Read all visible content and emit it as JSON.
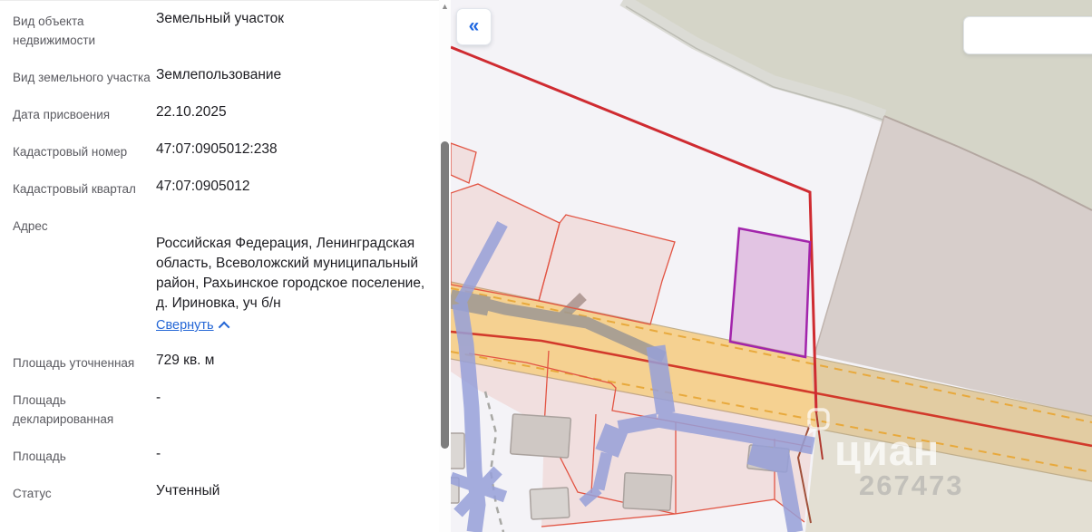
{
  "panel": {
    "rows": [
      {
        "label": "Вид объекта недвижимости",
        "value": "Земельный участок"
      },
      {
        "label": "Вид земельного участка",
        "value": "Землепользование"
      },
      {
        "label": "Дата присвоения",
        "value": "22.10.2025"
      },
      {
        "label": "Кадастровый номер",
        "value": "47:07:0905012:238"
      },
      {
        "label": "Кадастровый квартал",
        "value": "47:07:0905012"
      },
      {
        "label": "Адрес",
        "value": "Российская Федерация, Ленинградская область, Всеволожский муниципальный район, Рахьинское городское поселение, д. Ириновка, уч б/н",
        "collapse_label": "Свернуть"
      },
      {
        "label": "Площадь уточненная",
        "value": "729 кв. м"
      },
      {
        "label": "Площадь декларированная",
        "value": "-"
      },
      {
        "label": "Площадь",
        "value": "-"
      },
      {
        "label": "Статус",
        "value": "Учтенный"
      }
    ]
  },
  "scrollbar": {
    "up_arrow": "▲"
  },
  "map": {
    "collapse_button_glyph": "«",
    "search_value": "",
    "watermark": {
      "brand": "циан",
      "number": "267473"
    },
    "selected_parcel": {
      "cadastral_number": "47:07:0905012:238",
      "outline_color": "#a224ab",
      "fill_color": "rgba(192,108,188,0.35)"
    },
    "colors": {
      "base": "#f4f3f7",
      "forest": "#d5d5c8",
      "taupe_field": "#d7cecb",
      "khaki_field": "#e3dfd3",
      "road_fill": "#f5c97a",
      "road_marking_yellow": "#e8a93c",
      "road_marking_red": "#d2392b",
      "quarter_boundary_red": "#cf2b31",
      "parcel_outline_red": "#e25443",
      "parcel_fill_pink": "rgba(230,120,100,0.16)",
      "zone_blue": "#97a0d9",
      "building_grey": "#cfc8c4",
      "accent_blue": "#1e66e0"
    }
  }
}
